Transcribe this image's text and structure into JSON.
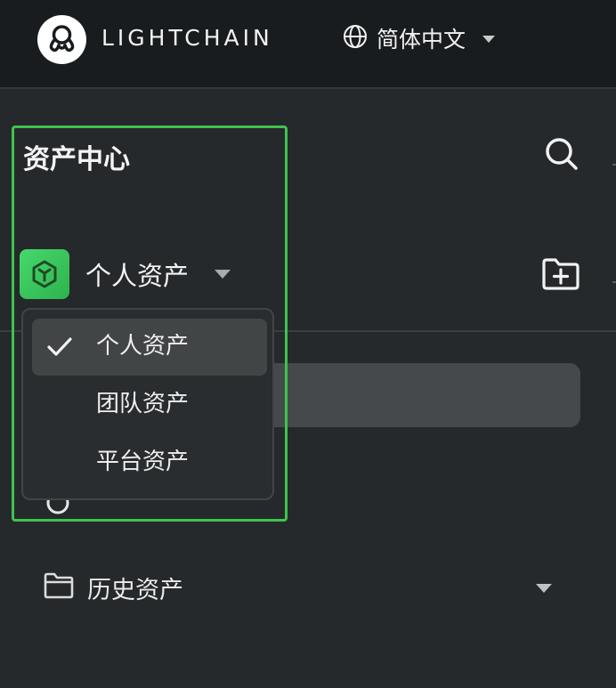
{
  "header": {
    "brand": "LIGHTCHAIN",
    "language_label": "简体中文",
    "logo_icon": "octopus-logo-icon",
    "language_icon": "globe-icon"
  },
  "panel": {
    "title": "资产中心",
    "search_icon": "search-icon",
    "scope_selector": {
      "selected_label": "个人资产",
      "icon": "cube-icon",
      "icon_color": "#3ac25a"
    },
    "new_folder_icon": "folder-plus-icon"
  },
  "dropdown": {
    "options": [
      {
        "label": "个人资产",
        "selected": true
      },
      {
        "label": "团队资产",
        "selected": false
      },
      {
        "label": "平台资产",
        "selected": false
      }
    ]
  },
  "tree": {
    "history_label": "历史资产",
    "history_icon": "folder-icon"
  },
  "colors": {
    "highlight": "#3fc34f",
    "background": "#26292b",
    "header_bg": "#181c1e"
  }
}
